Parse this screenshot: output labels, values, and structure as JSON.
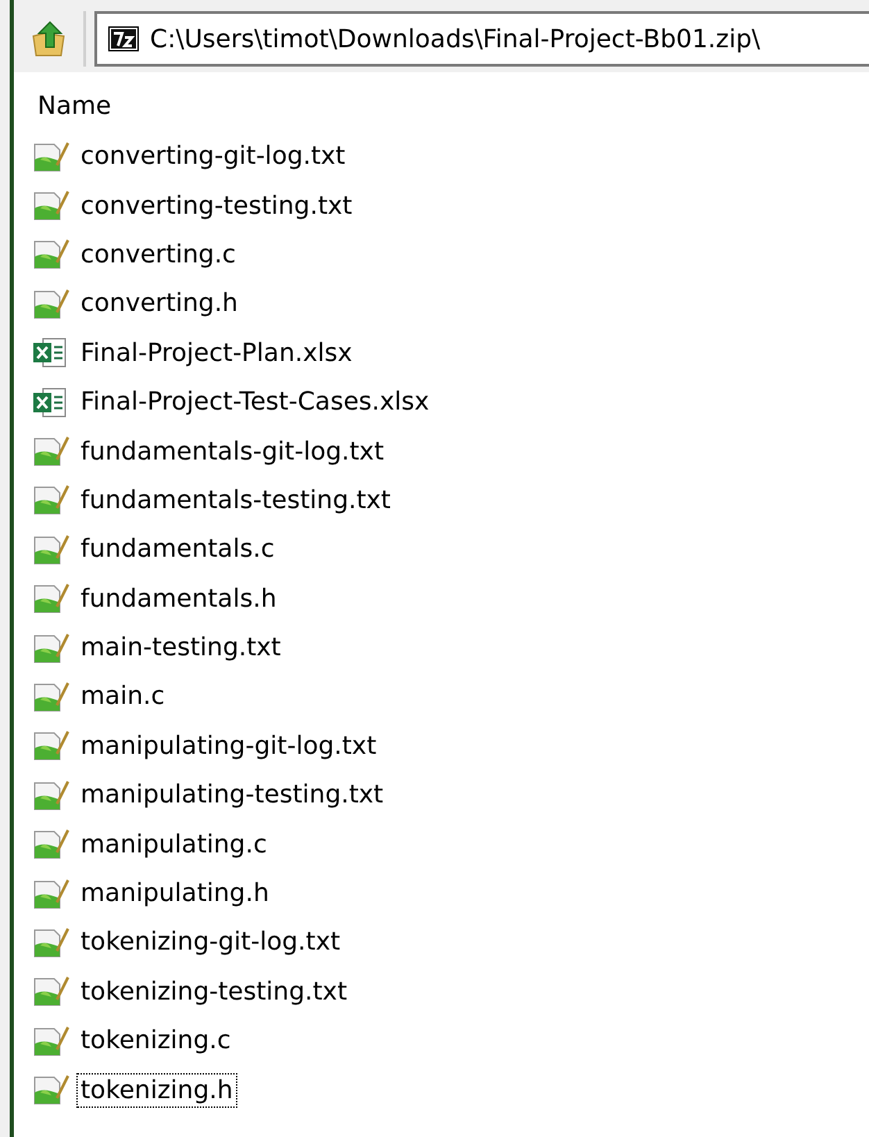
{
  "address_bar": {
    "path": "C:\\Users\\timot\\Downloads\\Final-Project-Bb01.zip\\"
  },
  "file_list": {
    "columns": [
      "Name"
    ],
    "items": [
      {
        "name": "converting-git-log.txt",
        "kind": "text",
        "focused": false
      },
      {
        "name": "converting-testing.txt",
        "kind": "text",
        "focused": false
      },
      {
        "name": "converting.c",
        "kind": "text",
        "focused": false
      },
      {
        "name": "converting.h",
        "kind": "text",
        "focused": false
      },
      {
        "name": "Final-Project-Plan.xlsx",
        "kind": "excel",
        "focused": false
      },
      {
        "name": "Final-Project-Test-Cases.xlsx",
        "kind": "excel",
        "focused": false
      },
      {
        "name": "fundamentals-git-log.txt",
        "kind": "text",
        "focused": false
      },
      {
        "name": "fundamentals-testing.txt",
        "kind": "text",
        "focused": false
      },
      {
        "name": "fundamentals.c",
        "kind": "text",
        "focused": false
      },
      {
        "name": "fundamentals.h",
        "kind": "text",
        "focused": false
      },
      {
        "name": "main-testing.txt",
        "kind": "text",
        "focused": false
      },
      {
        "name": "main.c",
        "kind": "text",
        "focused": false
      },
      {
        "name": "manipulating-git-log.txt",
        "kind": "text",
        "focused": false
      },
      {
        "name": "manipulating-testing.txt",
        "kind": "text",
        "focused": false
      },
      {
        "name": "manipulating.c",
        "kind": "text",
        "focused": false
      },
      {
        "name": "manipulating.h",
        "kind": "text",
        "focused": false
      },
      {
        "name": "tokenizing-git-log.txt",
        "kind": "text",
        "focused": false
      },
      {
        "name": "tokenizing-testing.txt",
        "kind": "text",
        "focused": false
      },
      {
        "name": "tokenizing.c",
        "kind": "text",
        "focused": false
      },
      {
        "name": "tokenizing.h",
        "kind": "text",
        "focused": true
      }
    ]
  }
}
